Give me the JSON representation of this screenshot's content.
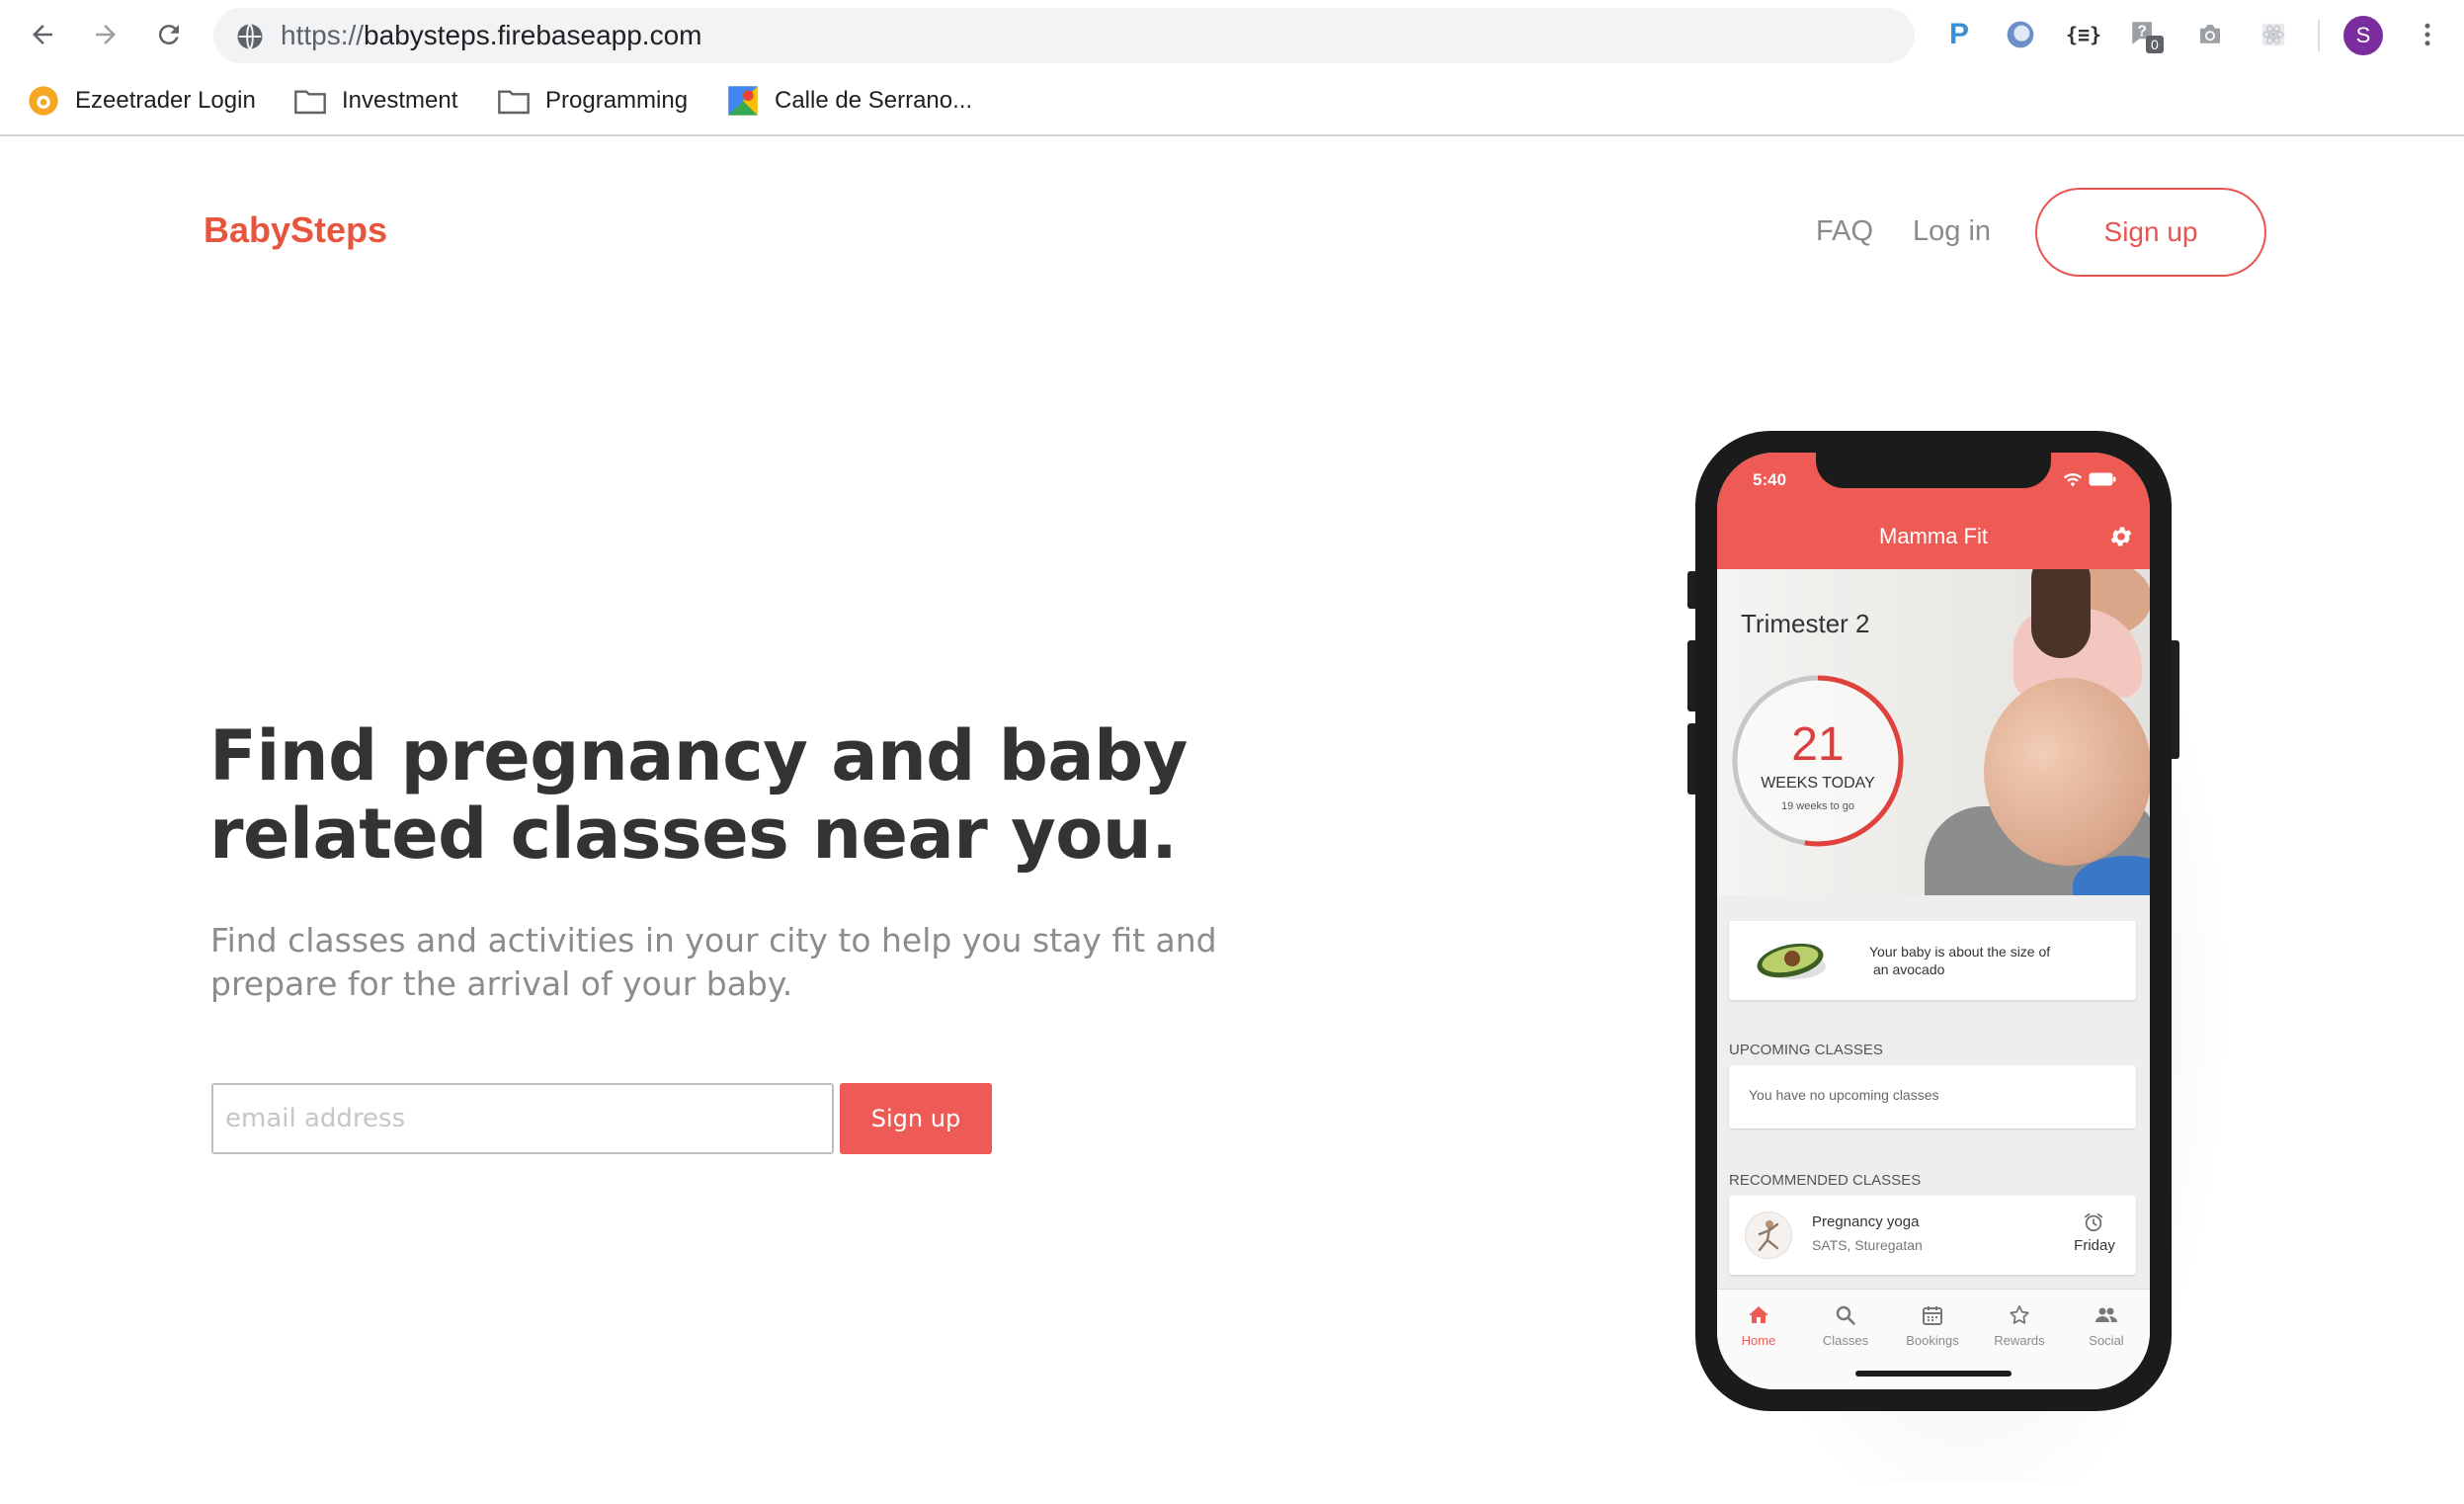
{
  "browser": {
    "url_scheme": "https://",
    "url_host": "babysteps.firebaseapp.com",
    "extensions": [
      "pocket-icon",
      "vpn-icon",
      "json-formatter-icon",
      "question-badge-icon",
      "camera-icon",
      "puzzle-icon"
    ],
    "extension_badge": "0",
    "profile_initial": "S",
    "bookmarks": [
      {
        "label": "Ezeetrader Login",
        "icon": "ezeetrader-icon"
      },
      {
        "label": "Investment",
        "icon": "folder-icon"
      },
      {
        "label": "Programming",
        "icon": "folder-icon"
      },
      {
        "label": "Calle de Serrano...",
        "icon": "maps-icon"
      }
    ]
  },
  "site": {
    "logo": "BabySteps",
    "nav": {
      "faq": "FAQ",
      "login": "Log in",
      "signup": "Sign up"
    },
    "brand_color": "#e8553e",
    "accent_color": "#ee5a55"
  },
  "hero": {
    "title_line1": "Find pregnancy and baby",
    "title_line2": "related classes near you.",
    "subtitle_line1": "Find classes and activities in your city to help you stay fit and",
    "subtitle_line2": "prepare for the arrival of your baby.",
    "email_placeholder": "email address",
    "signup_label": "Sign up"
  },
  "phone": {
    "time": "5:40",
    "app_title": "Mamma Fit",
    "trimester": "Trimester 2",
    "weeks": "21",
    "weeks_label": "WEEKS TODAY",
    "weeks_remaining": "19 weeks to go",
    "weeks_progress": 0.525,
    "baby_size_line1": "Your baby is about the size of",
    "baby_size_line2": "an avocado",
    "upcoming_header": "UPCOMING CLASSES",
    "upcoming_empty": "You have no upcoming classes",
    "recommended_header": "RECOMMENDED CLASSES",
    "recommended": [
      {
        "name": "Pregnancy yoga",
        "location": "SATS, Sturegatan",
        "day": "Friday"
      }
    ],
    "tabs": [
      {
        "label": "Home",
        "icon": "home-icon",
        "active": true
      },
      {
        "label": "Classes",
        "icon": "search-icon",
        "active": false
      },
      {
        "label": "Bookings",
        "icon": "calendar-icon",
        "active": false
      },
      {
        "label": "Rewards",
        "icon": "star-icon",
        "active": false
      },
      {
        "label": "Social",
        "icon": "people-icon",
        "active": false
      }
    ]
  }
}
